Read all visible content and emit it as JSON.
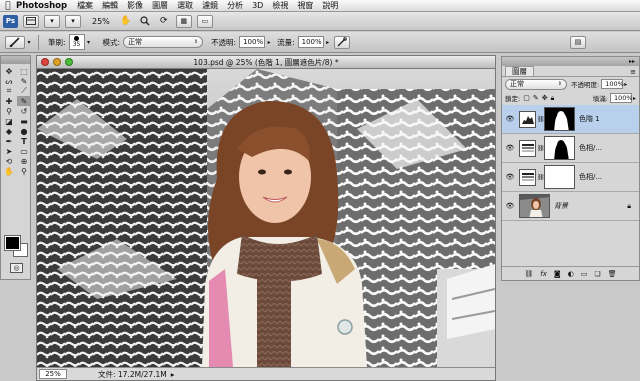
{
  "menubar": {
    "apple": "",
    "app": "Photoshop",
    "items": [
      "檔案",
      "編輯",
      "影像",
      "圖層",
      "選取",
      "濾鏡",
      "分析",
      "3D",
      "檢視",
      "視窗",
      "說明"
    ]
  },
  "appbar": {
    "ps": "Ps",
    "zoom": "25%"
  },
  "optionsbar": {
    "brush_label": "筆刷:",
    "brush_size": "35",
    "mode_label": "模式:",
    "mode_value": "正常",
    "opacity_label": "不透明:",
    "opacity_value": "100%",
    "flow_label": "流量:",
    "flow_value": "100%"
  },
  "document": {
    "title": "103.psd @ 25% (色階 1, 圖層遮色片/8) *",
    "zoom": "25%",
    "file_info": "文件: 17.2M/27.1M"
  },
  "layers_panel": {
    "tab": "圖層",
    "blend_mode": "正常",
    "opacity_label": "不透明度:",
    "opacity_value": "100%",
    "lock_label": "鎖定:",
    "fill_label": "填滿:",
    "fill_value": "100%",
    "layers": [
      {
        "name": "色階 1",
        "selected": true
      },
      {
        "name": "色相/...",
        "selected": false
      },
      {
        "name": "色相/...",
        "selected": false
      },
      {
        "name": "背景",
        "selected": false
      }
    ]
  },
  "colors": {
    "selection": "#b9d0ec",
    "ps_blue": "#2e5fa4",
    "close": "#e0443e",
    "minimize": "#dea123",
    "zoom": "#4bbf3a"
  }
}
